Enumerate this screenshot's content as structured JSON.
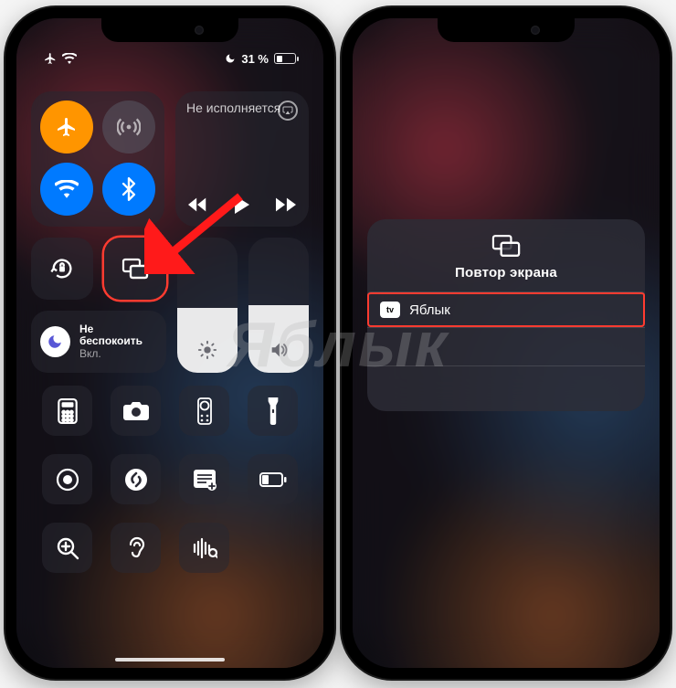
{
  "status": {
    "battery_text": "31 %"
  },
  "nowplaying": {
    "title": "Не исполняется"
  },
  "dnd": {
    "label": "Не беспокоить",
    "state": "Вкл."
  },
  "icons": {
    "airplane": "airplane-icon",
    "cellular": "cellular-icon",
    "wifi": "wifi-icon",
    "bluetooth": "bluetooth-icon",
    "lock": "rotation-lock-icon",
    "mirror": "screen-mirroring-icon",
    "brightness": "brightness-icon",
    "volume": "volume-icon",
    "calc": "calculator-icon",
    "camera": "camera-icon",
    "remote": "apple-tv-remote-icon",
    "torch": "flashlight-icon",
    "record": "screen-record-icon",
    "shazam": "shazam-icon",
    "notes": "quick-note-icon",
    "lowpower": "low-power-icon",
    "magnifier": "magnifier-icon",
    "hearing": "hearing-icon",
    "soundrec": "sound-recognition-icon"
  },
  "sliders": {
    "brightness_pct": 48,
    "volume_pct": 50
  },
  "mirror": {
    "title": "Повтор экрана",
    "device": "Яблык",
    "device_icon_label": "tv"
  },
  "watermark": "Яблык"
}
